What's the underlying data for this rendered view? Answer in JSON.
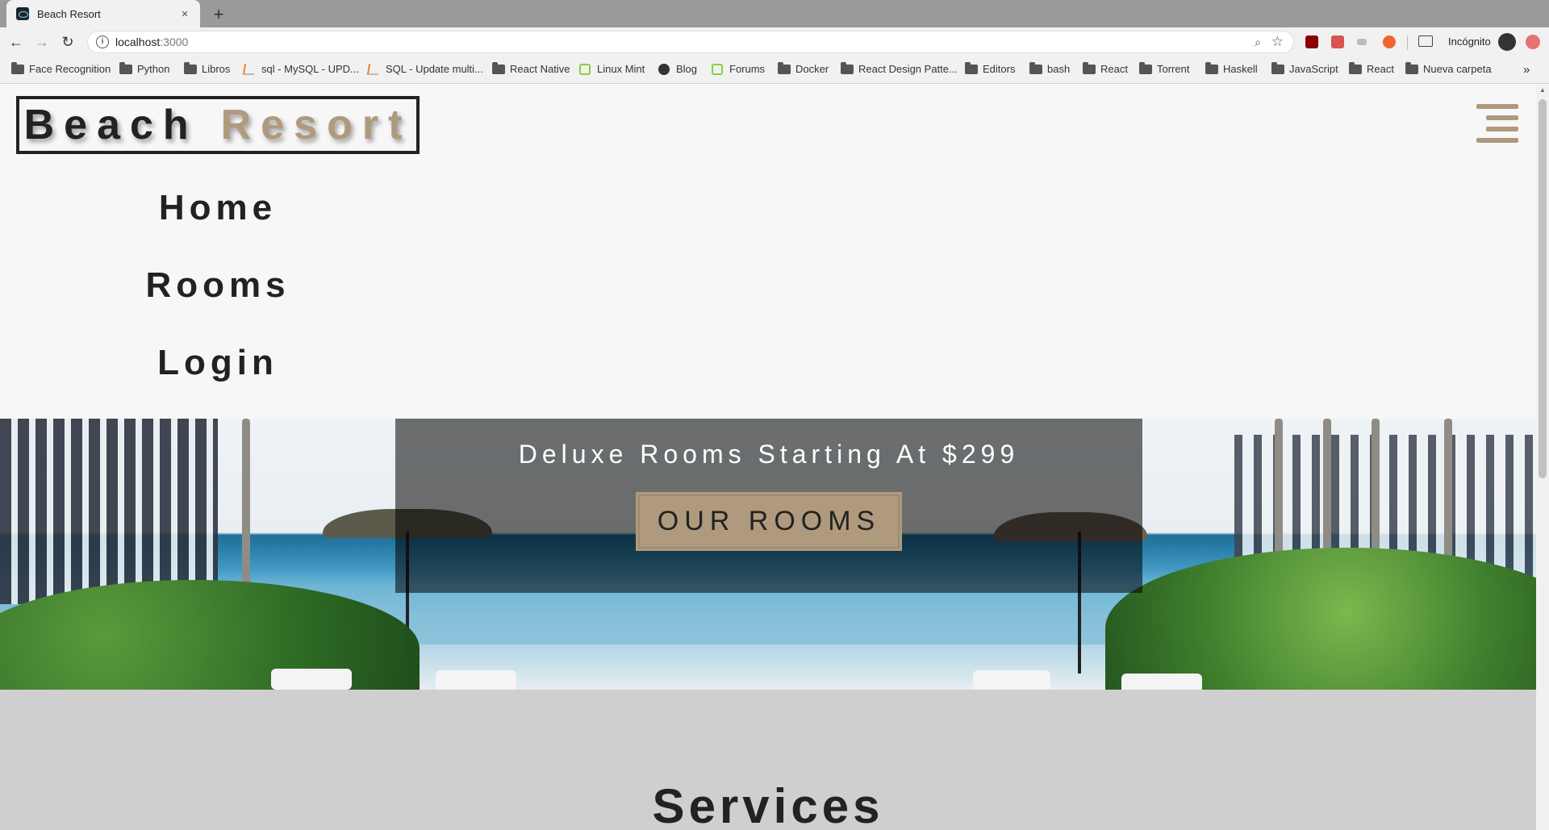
{
  "browser": {
    "tab_title": "Beach Resort",
    "tab_close": "×",
    "new_tab": "+",
    "url_host": "localhost",
    "url_port": ":3000",
    "incognito_label": "Incógnito",
    "bookmarks_overflow": "»",
    "bookmarks": [
      {
        "label": "Face Recognition",
        "icon": "folder-icon"
      },
      {
        "label": "Python",
        "icon": "folder-icon"
      },
      {
        "label": "Libros",
        "icon": "folder-icon"
      },
      {
        "label": "sql - MySQL - UPD...",
        "icon": "stackoverflow-icon"
      },
      {
        "label": "SQL - Update multi...",
        "icon": "stackoverflow-icon"
      },
      {
        "label": "React Native",
        "icon": "folder-icon"
      },
      {
        "label": "Linux Mint",
        "icon": "linux-mint-icon"
      },
      {
        "label": "Blog",
        "icon": "globe-icon"
      },
      {
        "label": "Forums",
        "icon": "linux-mint-icon"
      },
      {
        "label": "Docker",
        "icon": "folder-icon"
      },
      {
        "label": "React Design Patte...",
        "icon": "folder-icon"
      },
      {
        "label": "Editors",
        "icon": "folder-icon"
      },
      {
        "label": "bash",
        "icon": "folder-icon"
      },
      {
        "label": "React",
        "icon": "folder-icon"
      },
      {
        "label": "Torrent",
        "icon": "folder-icon"
      },
      {
        "label": "Haskell",
        "icon": "folder-icon"
      },
      {
        "label": "JavaScript",
        "icon": "folder-icon"
      },
      {
        "label": "React",
        "icon": "folder-icon"
      },
      {
        "label": "Nueva carpeta",
        "icon": "folder-icon"
      }
    ]
  },
  "site": {
    "logo_word1": "Beach",
    "logo_word2": "Resort",
    "nav": [
      "Home",
      "Rooms",
      "Login"
    ],
    "hero": {
      "subtitle": "Deluxe Rooms Starting At $299",
      "button": "our rooms"
    },
    "services_title": "Services"
  },
  "colors": {
    "accent": "#af9a7d",
    "text": "#222222",
    "page_bg": "#f7f7f7",
    "services_bg": "#cfcfcf"
  }
}
